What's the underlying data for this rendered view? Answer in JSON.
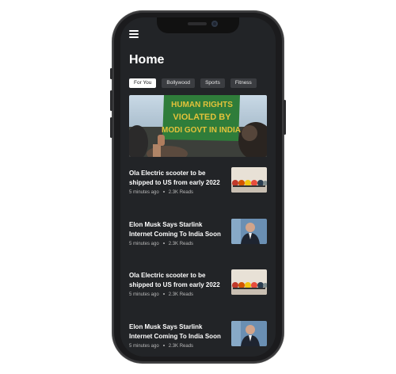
{
  "screen": {
    "title": "Home"
  },
  "tabs": [
    {
      "label": "For You",
      "active": true
    },
    {
      "label": "Bollywood",
      "active": false
    },
    {
      "label": "Sports",
      "active": false
    },
    {
      "label": "Fitness",
      "active": false
    }
  ],
  "hero": {
    "sign_lines": [
      "HUMAN RIGHTS",
      "VIOLATED BY",
      "MODI GOVT IN INDIA"
    ]
  },
  "news": [
    {
      "headline": "Ola Electric scooter to be shipped to US from early 2022",
      "time": "5 minutes ago",
      "reads": "2.3K Reads",
      "thumb": "scooters-thumbnail"
    },
    {
      "headline": "Elon Musk Says Starlink Internet Coming To India Soon",
      "time": "5 minutes ago",
      "reads": "2.3K Reads",
      "thumb": "man-portrait-thumbnail"
    },
    {
      "headline": "Ola Electric scooter to be shipped to US from early 2022",
      "time": "5 minutes ago",
      "reads": "2.3K Reads",
      "thumb": "scooters-thumbnail"
    },
    {
      "headline": "Elon Musk Says Starlink Internet Coming To India Soon",
      "time": "5 minutes ago",
      "reads": "2.3K Reads",
      "thumb": "man-portrait-thumbnail"
    }
  ],
  "colors": {
    "background": "#222427",
    "tab_inactive": "#3b3d41",
    "sign_green": "#2f7d3a",
    "sign_text": "#e2c23a"
  }
}
